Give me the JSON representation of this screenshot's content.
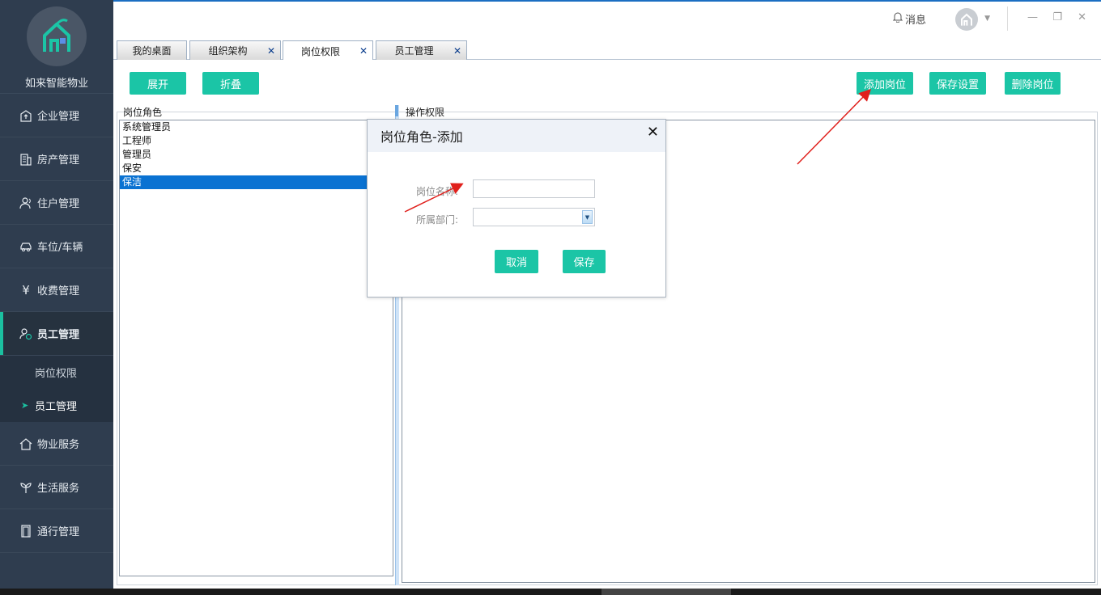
{
  "brand": {
    "name": "如来智能物业"
  },
  "sidebar": {
    "items": [
      {
        "label": "企业管理",
        "icon": "building-up-icon"
      },
      {
        "label": "房产管理",
        "icon": "building-icon"
      },
      {
        "label": "住户管理",
        "icon": "user-icon"
      },
      {
        "label": "车位/车辆",
        "icon": "car-icon"
      },
      {
        "label": "收费管理",
        "icon": "yen-icon"
      },
      {
        "label": "员工管理",
        "icon": "staff-icon"
      },
      {
        "label": "物业服务",
        "icon": "home-icon"
      },
      {
        "label": "生活服务",
        "icon": "sprout-icon"
      },
      {
        "label": "通行管理",
        "icon": "door-icon"
      }
    ],
    "submenu": [
      {
        "label": "岗位权限"
      },
      {
        "label": "员工管理"
      }
    ]
  },
  "topbar": {
    "message_label": "消息"
  },
  "tabs": [
    {
      "label": "我的桌面"
    },
    {
      "label": "组织架构"
    },
    {
      "label": "岗位权限"
    },
    {
      "label": "员工管理"
    }
  ],
  "toolbar": {
    "expand": "展开",
    "collapse": "折叠",
    "add_position": "添加岗位",
    "save_settings": "保存设置",
    "delete_position": "删除岗位"
  },
  "panels": {
    "left_title": "岗位角色",
    "right_title": "操作权限",
    "roles": [
      "系统管理员",
      "工程师",
      "管理员",
      "保安",
      "保洁"
    ],
    "selected_role": "保洁"
  },
  "dialog": {
    "title": "岗位角色-添加",
    "name_label": "岗位名称:",
    "dept_label": "所属部门:",
    "name_value": "",
    "cancel": "取消",
    "save": "保存"
  },
  "colors": {
    "accent": "#1bc5a6",
    "sidebar": "#2f3d4f",
    "selection": "#0a72d2",
    "annotation_arrow": "#e0201c"
  }
}
